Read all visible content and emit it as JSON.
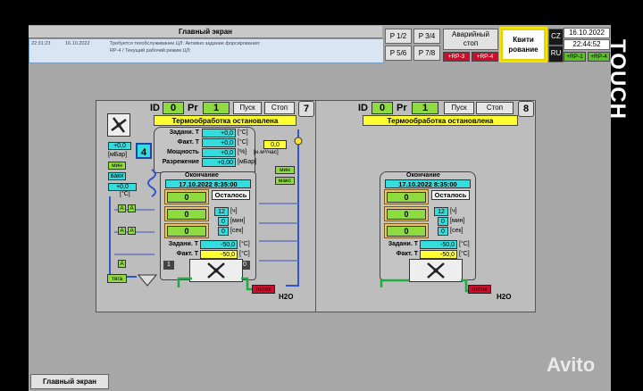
{
  "header": {
    "title": "Главный экран",
    "alarm": {
      "time": "22:31:23",
      "date": "16.10.2022",
      "message_line1": "Требуется техобслуживание ЦЛ: Активно задание форсирования:",
      "message_line2": "RP-4 / Текущий рабочий режим ЦЛ:"
    },
    "buttons": {
      "p12": "P 1/2",
      "p34": "P 3/4",
      "p56": "P 5/6",
      "p78": "P 7/8",
      "emergency_line1": "Аварийный",
      "emergency_line2": "стоп",
      "ack_line1": "Квити",
      "ack_line2": "рование",
      "lang_cz": "CZ",
      "lang_ru": "RU"
    },
    "rp": [
      "+RP-3",
      "+RP-4",
      "+RP-1",
      "+RP-4"
    ],
    "date": "16.10.2022",
    "time": "22:44:52"
  },
  "brand": "TOUCH",
  "watermark": "Avito",
  "units": [
    {
      "id_label": "ID",
      "id_value": "0",
      "pr_label": "Pr",
      "pr_value": "1",
      "start": "Пуск",
      "stop": "Стоп",
      "number": "7",
      "status": "Термообработка остановлена",
      "setpoint_label": "Задани. Т",
      "setpoint_value": "+0,0",
      "setpoint_unit": "[°C]",
      "actual_label": "Факт. Т",
      "actual_value": "+0,0",
      "actual_unit": "[°C]",
      "power_label": "Мощность",
      "power_value": "+0,0",
      "power_unit": "[%]",
      "flow_unit": "[н.м³/час]",
      "flow_value": "0,0",
      "vacuum_label": "Разрежение",
      "vacuum_value": "+0,00",
      "vacuum_unit": "[мБар]",
      "left_val1": "+0,0",
      "left_unit1": "[мБар]",
      "left_min": "мин",
      "left_vacuum": "ваки",
      "left_val2": "+0,0",
      "left_unit2": "[°C]",
      "badge": "4",
      "a_labels": [
        "A",
        "A",
        "A",
        "A",
        "A"
      ],
      "right_min": "мин",
      "right_max": "макс",
      "end_label": "Окончание",
      "end_date": "17.10.2022 8:35:00",
      "remaining": "Осталось",
      "slot_values": [
        "0",
        "0",
        "0"
      ],
      "hours": "12",
      "hours_unit": "[ч]",
      "minutes": "0",
      "minutes_unit": "[мин]",
      "seconds": "0",
      "seconds_unit": "[сек]",
      "bottom_set_label": "Задани. Т",
      "bottom_set_value": "-50,0",
      "bottom_set_unit": "[°C]",
      "bottom_act_label": "Факт. Т",
      "bottom_act_value": "-50,0",
      "bottom_act_unit": "[°C]",
      "io_one": "1",
      "io_zero": "0",
      "draft": "тяга",
      "flow_label": "поток",
      "h2o": "H2O"
    },
    {
      "id_label": "ID",
      "id_value": "0",
      "pr_label": "Pr",
      "pr_value": "1",
      "start": "Пуск",
      "stop": "Стоп",
      "number": "8",
      "status": "Термообработка остановлена",
      "end_label": "Окончание",
      "end_date": "17.10.2022 8:35:00",
      "remaining": "Осталось",
      "slot_values": [
        "0",
        "0",
        "0"
      ],
      "hours": "12",
      "hours_unit": "[ч]",
      "minutes": "0",
      "minutes_unit": "[мин]",
      "seconds": "0",
      "seconds_unit": "[сек]",
      "bottom_set_label": "Задани. Т",
      "bottom_set_value": "-50,0",
      "bottom_set_unit": "[°C]",
      "bottom_act_label": "Факт. Т",
      "bottom_act_value": "-50,0",
      "bottom_act_unit": "[°C]",
      "flow_label": "поток",
      "h2o": "H2O"
    }
  ],
  "footer_tab": "Главный экран",
  "colors": {
    "green": "#8ddb3f",
    "yellow": "#ffff33",
    "cyan": "#33dddd",
    "red": "#c8102e",
    "panel": "#bdbdbd"
  }
}
